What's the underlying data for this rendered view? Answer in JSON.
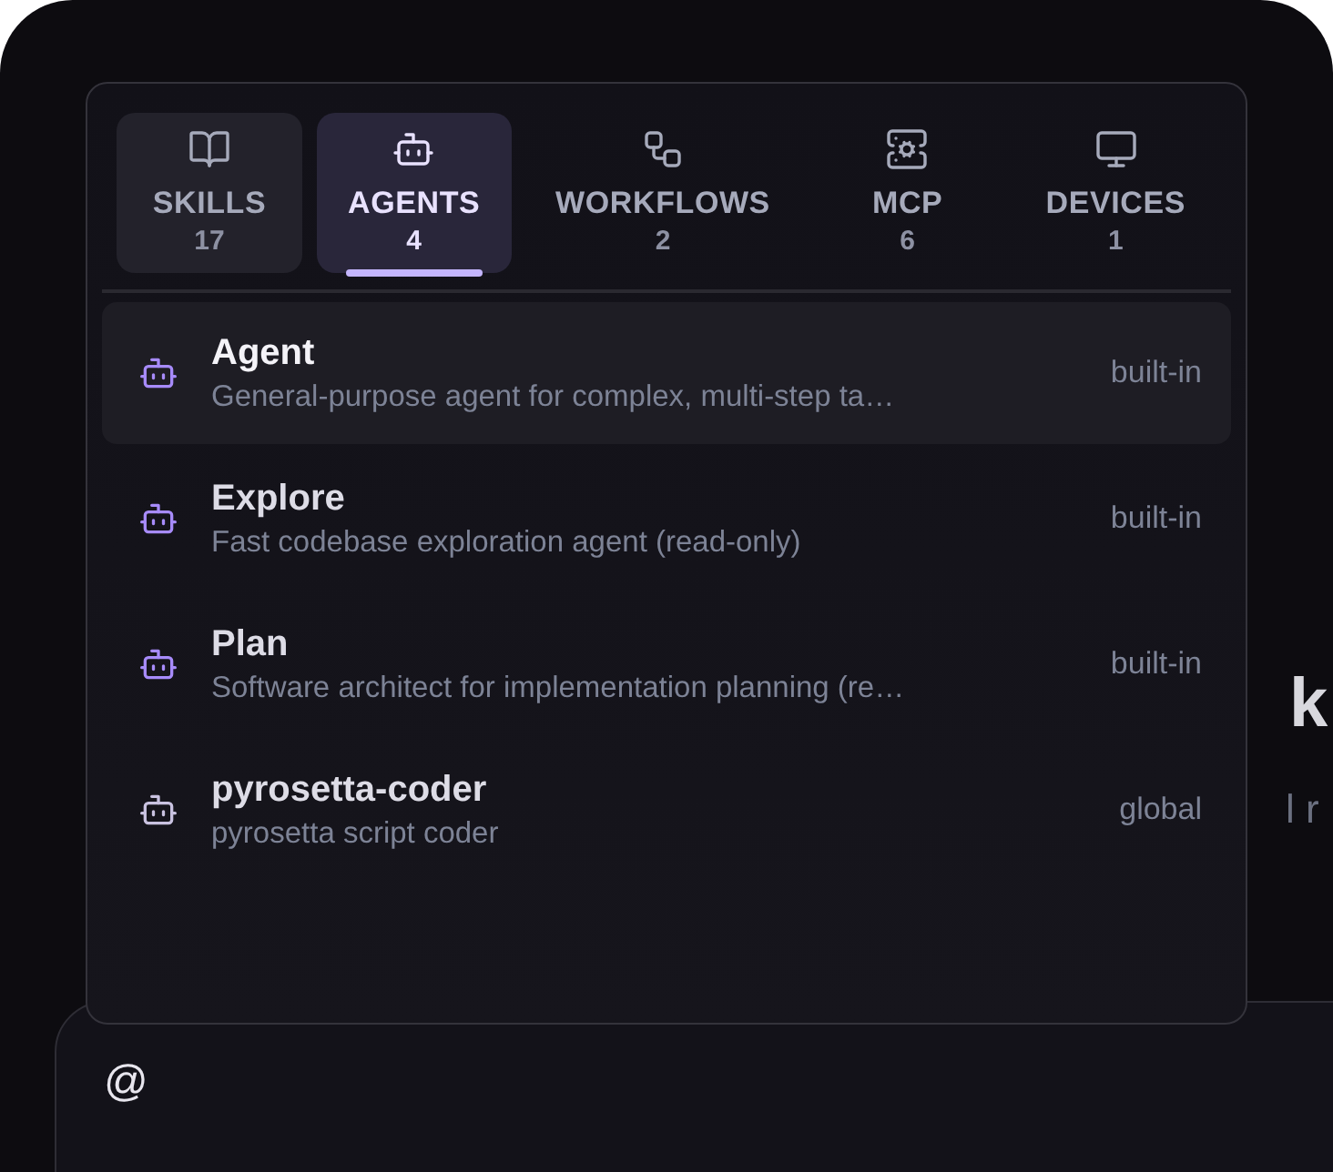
{
  "background": {
    "heading": "k",
    "subtitle": "l r"
  },
  "tabs": [
    {
      "label": "SKILLS",
      "count": "17",
      "selected": false,
      "highlighted": true
    },
    {
      "label": "AGENTS",
      "count": "4",
      "selected": true,
      "highlighted": false
    },
    {
      "label": "WORKFLOWS",
      "count": "2",
      "selected": false,
      "highlighted": false
    },
    {
      "label": "MCP",
      "count": "6",
      "selected": false,
      "highlighted": false
    },
    {
      "label": "DEVICES",
      "count": "1",
      "selected": false,
      "highlighted": false
    }
  ],
  "agents": [
    {
      "name": "Agent",
      "description": "General-purpose agent for complex, multi-step ta…",
      "scope": "built-in",
      "kind": "builtin",
      "selected": true
    },
    {
      "name": "Explore",
      "description": "Fast codebase exploration agent (read-only)",
      "scope": "built-in",
      "kind": "builtin",
      "selected": false
    },
    {
      "name": "Plan",
      "description": "Software architect for implementation planning (re…",
      "scope": "built-in",
      "kind": "builtin",
      "selected": false
    },
    {
      "name": "pyrosetta-coder",
      "description": "pyrosetta script coder",
      "scope": "global",
      "kind": "custom",
      "selected": false
    }
  ],
  "input": {
    "value": "@"
  }
}
